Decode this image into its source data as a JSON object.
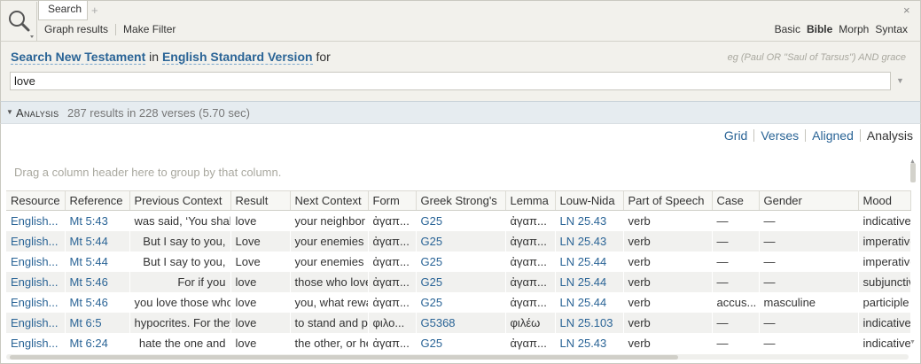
{
  "tabs": {
    "active_label": "Search",
    "add_label": "+",
    "close_label": "×"
  },
  "toolbar": {
    "graph_results": "Graph results",
    "make_filter": "Make Filter",
    "modes": [
      {
        "label": "Basic",
        "active": false
      },
      {
        "label": "Bible",
        "active": true
      },
      {
        "label": "Morph",
        "active": false
      },
      {
        "label": "Syntax",
        "active": false
      }
    ]
  },
  "search": {
    "prefix": "Search",
    "scope": "New Testament",
    "in_word": "in",
    "version": "English Standard Version",
    "for_word": "for",
    "example_hint": "eg (Paul OR \"Saul of Tarsus\") AND grace",
    "query_value": "love"
  },
  "analysis": {
    "title": "Analysis",
    "summary": "287 results in 228 verses (5.70 sec)"
  },
  "view_tabs": [
    {
      "label": "Grid",
      "active": false
    },
    {
      "label": "Verses",
      "active": false
    },
    {
      "label": "Aligned",
      "active": false
    },
    {
      "label": "Analysis",
      "active": true
    }
  ],
  "group_hint": "Drag a column header here to group by that column.",
  "grid": {
    "columns": [
      "Resource",
      "Reference",
      "Previous Context",
      "Result",
      "Next Context",
      "Form",
      "Greek Strong's",
      "Lemma",
      "Louw-Nida",
      "Part of Speech",
      "Case",
      "Gender",
      "Mood"
    ],
    "rows": [
      [
        "English...",
        "Mt 5:43",
        "was said, ‘You shall",
        "love",
        "your neighbor",
        "ἀγαπ...",
        "G25",
        "ἀγαπ...",
        "LN 25.43",
        "verb",
        "—",
        "—",
        "indicative"
      ],
      [
        "English...",
        "Mt 5:44",
        "But I say to you,",
        "Love",
        "your enemies",
        "ἀγαπ...",
        "G25",
        "ἀγαπ...",
        "LN 25.43",
        "verb",
        "—",
        "—",
        "imperative"
      ],
      [
        "English...",
        "Mt 5:44",
        "But I say to you,",
        "Love",
        "your enemies",
        "ἀγαπ...",
        "G25",
        "ἀγαπ...",
        "LN 25.44",
        "verb",
        "—",
        "—",
        "imperative"
      ],
      [
        "English...",
        "Mt 5:46",
        "For if you",
        "love",
        "those who love",
        "ἀγαπ...",
        "G25",
        "ἀγαπ...",
        "LN 25.44",
        "verb",
        "—",
        "—",
        "subjunctive"
      ],
      [
        "English...",
        "Mt 5:46",
        "you love those who",
        "love",
        "you, what reward",
        "ἀγαπ...",
        "G25",
        "ἀγαπ...",
        "LN 25.44",
        "verb",
        "accus...",
        "masculine",
        "participle"
      ],
      [
        "English...",
        "Mt 6:5",
        "hypocrites. For they",
        "love",
        "to stand and pray",
        "φιλο...",
        "G5368",
        "φιλέω",
        "LN 25.103",
        "verb",
        "—",
        "—",
        "indicative"
      ],
      [
        "English...",
        "Mt 6:24",
        "hate the one and",
        "love",
        "the other, or he",
        "ἀγαπ...",
        "G25",
        "ἀγαπ...",
        "LN 25.43",
        "verb",
        "—",
        "—",
        "indicative"
      ]
    ]
  },
  "colors": {
    "link": "#2a6496",
    "toolbar_bg": "#f2f1ec",
    "analysis_bg": "#e6ecf0",
    "alt_row": "#f1f1ef"
  }
}
